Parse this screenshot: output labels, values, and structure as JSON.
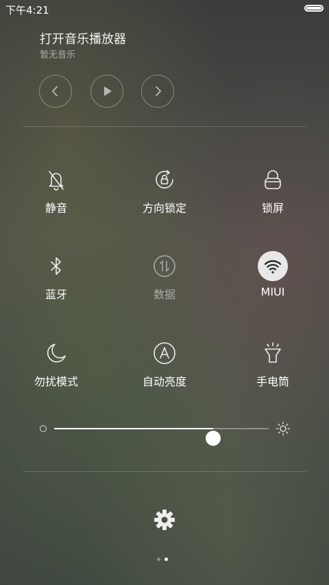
{
  "status": {
    "time": "下午4:21"
  },
  "music": {
    "title": "打开音乐播放器",
    "subtitle": "暂无音乐",
    "controls": [
      {
        "name": "previous-button",
        "icon": "chevron-left-icon"
      },
      {
        "name": "play-button",
        "icon": "play-icon"
      },
      {
        "name": "next-button",
        "icon": "chevron-right-icon"
      }
    ]
  },
  "toggles": [
    {
      "label": "静音",
      "icon": "bell-off-icon",
      "active": false,
      "enabled": true
    },
    {
      "label": "方向锁定",
      "icon": "rotation-lock-icon",
      "active": false,
      "enabled": true
    },
    {
      "label": "锁屏",
      "icon": "lock-icon",
      "active": false,
      "enabled": true
    },
    {
      "label": "蓝牙",
      "icon": "bluetooth-icon",
      "active": false,
      "enabled": true
    },
    {
      "label": "数据",
      "icon": "mobile-data-icon",
      "active": false,
      "enabled": false
    },
    {
      "label": "MIUI",
      "icon": "wifi-icon",
      "active": true,
      "enabled": true
    },
    {
      "label": "勿扰模式",
      "icon": "moon-icon",
      "active": false,
      "enabled": true
    },
    {
      "label": "自动亮度",
      "icon": "auto-brightness-icon",
      "active": false,
      "enabled": true
    },
    {
      "label": "手电筒",
      "icon": "flashlight-icon",
      "active": false,
      "enabled": true
    }
  ],
  "brightness": {
    "level_percent": 74
  },
  "pager": {
    "pages": 2,
    "current": 2
  },
  "colors": {
    "active_bg": "#e8e8e8",
    "active_fg": "#2b2b2b"
  }
}
